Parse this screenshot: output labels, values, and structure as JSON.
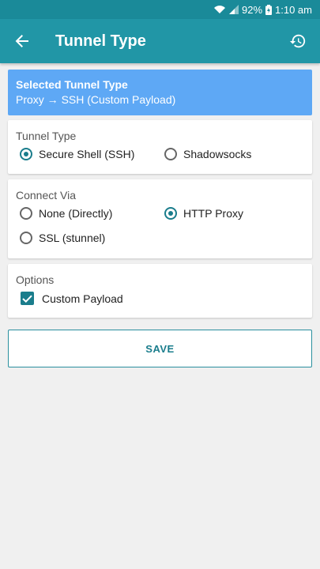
{
  "status": {
    "battery": "92%",
    "time": "1:10 am"
  },
  "appbar": {
    "title": "Tunnel Type"
  },
  "banner": {
    "heading": "Selected Tunnel Type",
    "value": "Proxy → SSH (Custom Payload)"
  },
  "tunnel_type": {
    "label": "Tunnel Type",
    "options": [
      {
        "label": "Secure Shell (SSH)",
        "selected": true
      },
      {
        "label": "Shadowsocks",
        "selected": false
      }
    ]
  },
  "connect_via": {
    "label": "Connect Via",
    "options": [
      {
        "label": "None (Directly)",
        "selected": false
      },
      {
        "label": "HTTP Proxy",
        "selected": true
      },
      {
        "label": "SSL (stunnel)",
        "selected": false
      }
    ]
  },
  "options": {
    "label": "Options",
    "custom_payload": {
      "label": "Custom Payload",
      "checked": true
    }
  },
  "save_button": {
    "label": "SAVE"
  },
  "colors": {
    "appbar": "#2196a6",
    "statusbar": "#1a8a99",
    "banner": "#5ea8f5",
    "accent": "#1a7d8c"
  }
}
